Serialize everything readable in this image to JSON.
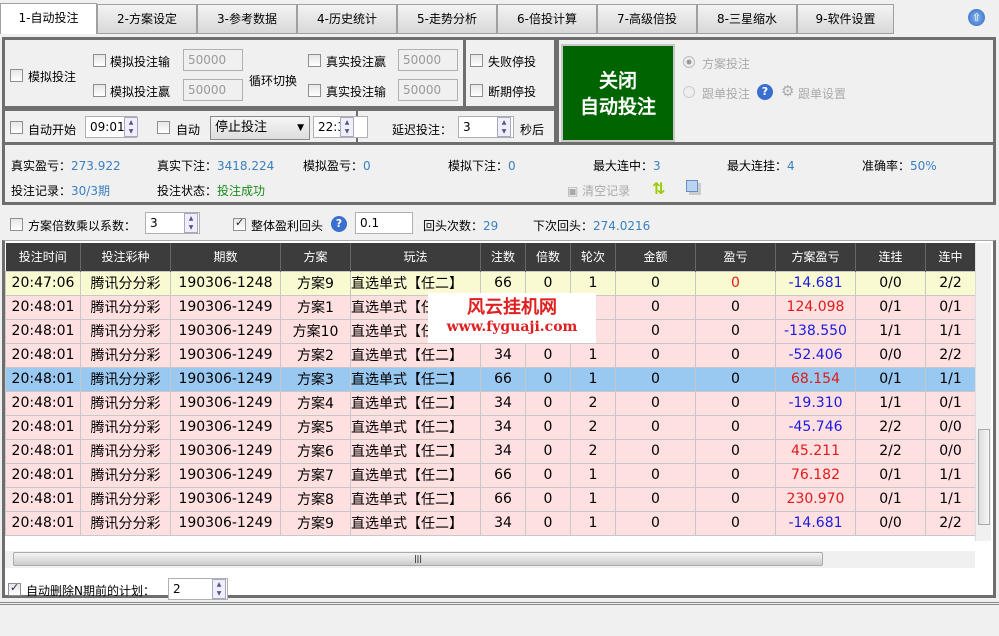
{
  "tabs": [
    "1-自动投注",
    "2-方案设定",
    "3-参考数据",
    "4-历史统计",
    "5-走势分析",
    "6-倍投计算",
    "7-高级倍投",
    "8-三星缩水",
    "9-软件设置"
  ],
  "controls": {
    "sim_bet": "模拟投注",
    "sim_lose": "模拟投注输",
    "sim_win": "模拟投注赢",
    "sim_lose_val": "50000",
    "sim_win_val": "50000",
    "cycle": "循环切换",
    "real_win": "真实投注赢",
    "real_lose": "真实投注输",
    "real_win_val": "50000",
    "real_lose_val": "50000",
    "fail_stop": "失败停投",
    "break_stop": "断期停投",
    "auto_start": "自动开始",
    "start_time": "09:01",
    "auto": "自动",
    "auto_action": "停止投注",
    "end_time": "22:32",
    "delay_label": "延迟投注：",
    "delay_val": "3",
    "delay_unit": "秒后",
    "main_button_line1": "关闭",
    "main_button_line2": "自动投注",
    "plan_bet": "方案投注",
    "follow_bet": "跟单投注",
    "follow_settings": "跟单设置"
  },
  "stats": {
    "real_pl_label": "真实盈亏：",
    "real_pl": "273.922",
    "real_bet_label": "真实下注：",
    "real_bet": "3418.224",
    "sim_pl_label": "模拟盈亏：",
    "sim_pl": "0",
    "sim_bet_label": "模拟下注：",
    "sim_bet": "0",
    "max_win_label": "最大连中：",
    "max_win": "3",
    "max_lose_label": "最大连挂：",
    "max_lose": "4",
    "accuracy_label": "准确率：",
    "accuracy": "50%",
    "record_label": "投注记录：",
    "record": "30/3期",
    "status_label": "投注状态：",
    "status": "投注成功",
    "clear": "清空记录"
  },
  "options": {
    "multiply_label": "方案倍数乘以系数：",
    "multiply_val": "3",
    "rollback_label": "整体盈利回头",
    "rollback_val": "0.1",
    "rollback_count_label": "回头次数：",
    "rollback_count": "29",
    "next_rollback_label": "下次回头：",
    "next_rollback": "274.0216"
  },
  "table": {
    "headers": [
      "投注时间",
      "投注彩种",
      "期数",
      "方案",
      "玩法",
      "注数",
      "倍数",
      "轮次",
      "金额",
      "盈亏",
      "方案盈亏",
      "连挂",
      "连中"
    ],
    "rows": [
      [
        "20:47:06",
        "腾讯分分彩",
        "190306-1248",
        "方案9",
        "直选单式【任二】",
        "66",
        "0",
        "1",
        "0",
        "0",
        "-14.681",
        "0/0",
        "2/2"
      ],
      [
        "20:48:01",
        "腾讯分分彩",
        "190306-1249",
        "方案1",
        "直选单式【任二】",
        "",
        "",
        "",
        "0",
        "0",
        "124.098",
        "0/1",
        "0/1"
      ],
      [
        "20:48:01",
        "腾讯分分彩",
        "190306-1249",
        "方案10",
        "直选单式【任二】",
        "",
        "",
        "",
        "0",
        "0",
        "-138.550",
        "1/1",
        "1/1"
      ],
      [
        "20:48:01",
        "腾讯分分彩",
        "190306-1249",
        "方案2",
        "直选单式【任二】",
        "34",
        "0",
        "1",
        "0",
        "0",
        "-52.406",
        "0/0",
        "2/2"
      ],
      [
        "20:48:01",
        "腾讯分分彩",
        "190306-1249",
        "方案3",
        "直选单式【任二】",
        "66",
        "0",
        "1",
        "0",
        "0",
        "68.154",
        "0/1",
        "1/1"
      ],
      [
        "20:48:01",
        "腾讯分分彩",
        "190306-1249",
        "方案4",
        "直选单式【任二】",
        "34",
        "0",
        "2",
        "0",
        "0",
        "-19.310",
        "1/1",
        "0/1"
      ],
      [
        "20:48:01",
        "腾讯分分彩",
        "190306-1249",
        "方案5",
        "直选单式【任二】",
        "34",
        "0",
        "2",
        "0",
        "0",
        "-45.746",
        "2/2",
        "0/0"
      ],
      [
        "20:48:01",
        "腾讯分分彩",
        "190306-1249",
        "方案6",
        "直选单式【任二】",
        "34",
        "0",
        "2",
        "0",
        "0",
        "45.211",
        "2/2",
        "0/0"
      ],
      [
        "20:48:01",
        "腾讯分分彩",
        "190306-1249",
        "方案7",
        "直选单式【任二】",
        "66",
        "0",
        "1",
        "0",
        "0",
        "76.182",
        "0/1",
        "1/1"
      ],
      [
        "20:48:01",
        "腾讯分分彩",
        "190306-1249",
        "方案8",
        "直选单式【任二】",
        "66",
        "0",
        "1",
        "0",
        "0",
        "230.970",
        "0/1",
        "1/1"
      ],
      [
        "20:48:01",
        "腾讯分分彩",
        "190306-1249",
        "方案9",
        "直选单式【任二】",
        "34",
        "0",
        "1",
        "0",
        "0",
        "-14.681",
        "0/0",
        "2/2"
      ]
    ]
  },
  "watermark": {
    "name": "风云挂机网",
    "url": "www.fyguaji.com"
  },
  "footer": {
    "auto_delete_label": "自动删除N期前的计划：",
    "auto_delete_val": "2"
  },
  "colors": {
    "button_bg": "#006400",
    "selected_row": "#99c8f0",
    "pink_row": "#ffe0e0",
    "yellow_row": "#fafad2"
  }
}
